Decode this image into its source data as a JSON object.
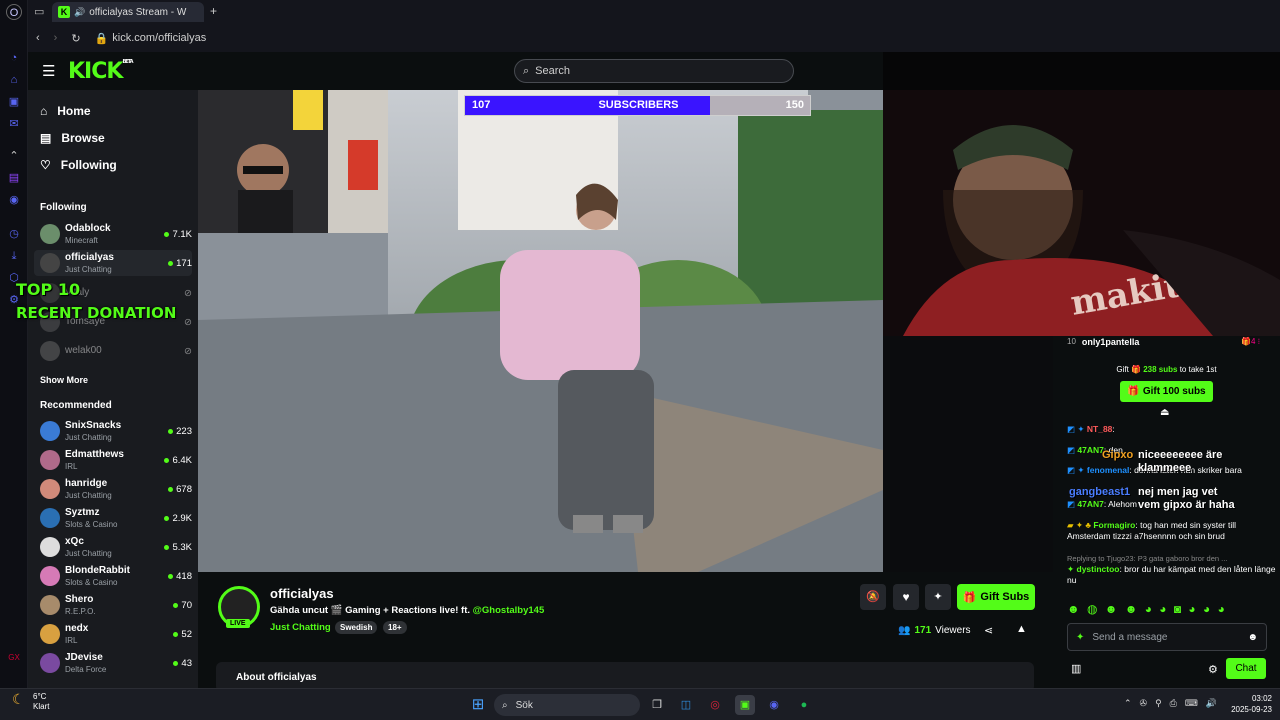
{
  "browser": {
    "tab_title": "officialyas Stream - W",
    "url": "kick.com/officialyas"
  },
  "kick": {
    "logo": "KICK",
    "logo_tag": "BETA",
    "search_placeholder": "Search",
    "nav": [
      {
        "label": "Home",
        "icon": "home-icon"
      },
      {
        "label": "Browse",
        "icon": "browse-icon"
      },
      {
        "label": "Following",
        "icon": "heart-icon"
      }
    ],
    "following_header": "Following",
    "following": [
      {
        "name": "Odablock",
        "category": "Minecraft",
        "viewers": "7.1K",
        "live": true
      },
      {
        "name": "officialyas",
        "category": "Just Chatting",
        "viewers": "171",
        "live": true
      },
      {
        "name": "Vitaly",
        "category": "",
        "viewers": "",
        "live": false
      },
      {
        "name": "Tomsaye",
        "category": "",
        "viewers": "",
        "live": false
      },
      {
        "name": "welak00",
        "category": "",
        "viewers": "",
        "live": false
      }
    ],
    "show_more": "Show More",
    "recommended_header": "Recommended",
    "recommended": [
      {
        "name": "SnixSnacks",
        "category": "Just Chatting",
        "viewers": "223"
      },
      {
        "name": "Edmatthews",
        "category": "IRL",
        "viewers": "6.4K"
      },
      {
        "name": "hanridge",
        "category": "Just Chatting",
        "viewers": "678"
      },
      {
        "name": "Syztmz",
        "category": "Slots & Casino",
        "viewers": "2.9K"
      },
      {
        "name": "xQc",
        "category": "Just Chatting",
        "viewers": "5.3K"
      },
      {
        "name": "BlondeRabbit",
        "category": "Slots & Casino",
        "viewers": "418"
      },
      {
        "name": "Shero",
        "category": "R.E.P.O.",
        "viewers": "70"
      },
      {
        "name": "nedx",
        "category": "IRL",
        "viewers": "52"
      },
      {
        "name": "JDevise",
        "category": "Delta Force",
        "viewers": "43"
      }
    ],
    "overlay_top": "TOP 10",
    "overlay_donation": "RECENT DONATION",
    "sub_goal": {
      "current": "107",
      "label": "SUBSCRIBERS",
      "target": "150",
      "progress": 0.71
    },
    "streamer": {
      "name": "officialyas",
      "live_badge": "LIVE",
      "title": "Gähda uncut 🎬 Gaming + Reactions live! ft.",
      "mention": "@Ghostalby145",
      "category": "Just Chatting",
      "tags": [
        "Swedish",
        "18+"
      ],
      "viewers": "171",
      "viewers_label": "Viewers",
      "gift_subs": "Gift Subs"
    },
    "about_partial": "About officialyas"
  },
  "chat": {
    "pinned_user": "only1pantella",
    "pinned_rank": "10",
    "gift_prompt_pre": "Gift",
    "gift_prompt_count": "238 subs",
    "gift_prompt_post": "to take 1st",
    "gift_button": "Gift 100 subs",
    "messages": [
      {
        "user": "NT_88",
        "color": "#ff5a5a",
        "text": ""
      },
      {
        "user": "47AN7",
        "color": "#53fc18",
        "text": "den"
      },
      {
        "user": "fenomenal",
        "color": "#1e90ff",
        "text": "denna låten han skriker bara"
      },
      {
        "user": "47AN7",
        "color": "#53fc18",
        "text": "Alehom"
      },
      {
        "user": "Formagiro",
        "color": "#53fc18",
        "text": "tog han med sin syster till Amsterdam tizzzi a7hsennnn och sin brud"
      },
      {
        "user": "dystinctoo",
        "color": "#53fc18",
        "text": "bror du har kämpat med den låten länge nu"
      }
    ],
    "reply_note": "Replying to Tjugo23: P3 gata gaboro bror den ...",
    "overlay_lines": [
      {
        "user": "Gipxo",
        "text": "niceeeeeeee äre klammeee"
      },
      {
        "user": "gangbeast1",
        "text": "nej men jag vet vem gipxo är haha"
      }
    ],
    "input_placeholder": "Send a message",
    "chat_button": "Chat"
  },
  "taskbar": {
    "weather_temp": "6°C",
    "weather_text": "Klart",
    "search_label": "Sök",
    "time": "03:02",
    "date": "2025-09-23"
  }
}
